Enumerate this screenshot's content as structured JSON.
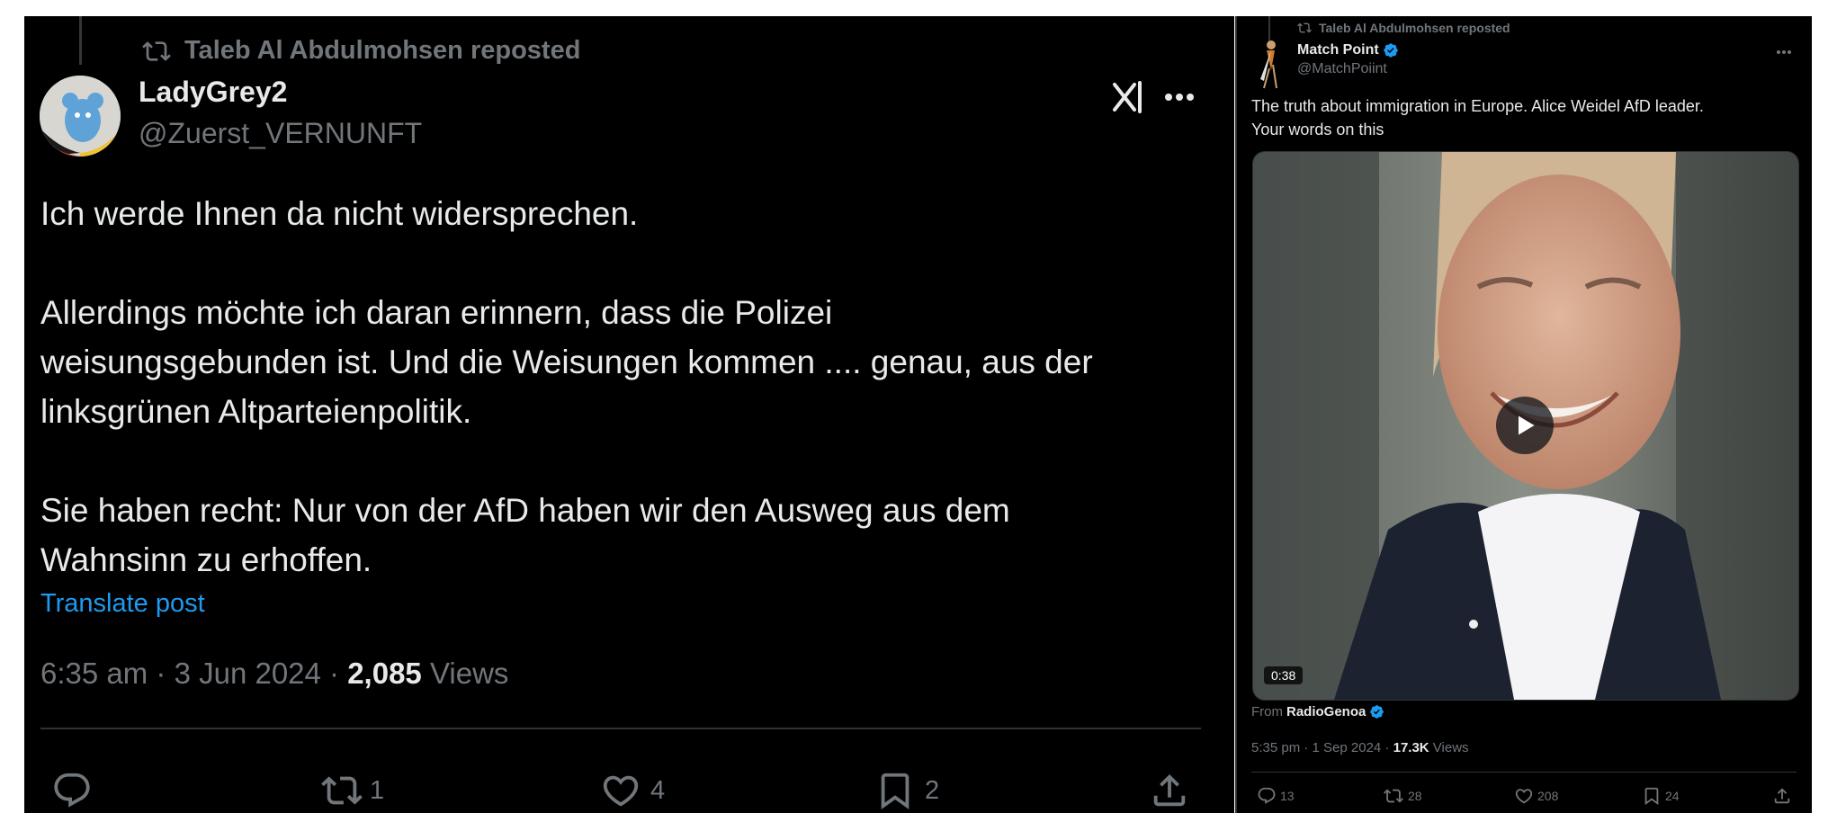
{
  "left": {
    "repost": {
      "text": "Taleb Al Abdulmohsen reposted"
    },
    "author": {
      "name": "LadyGrey2",
      "handle": "@Zuerst_VERNUNFT"
    },
    "body": "Ich werde Ihnen da nicht widersprechen.\n\nAllerdings möchte ich daran erinnern, dass die Polizei\nweisungsgebunden ist. Und die Weisungen kommen .... genau, aus der\nlinksgrünen Altparteienpolitik.\n\nSie haben recht: Nur von der AfD haben wir den Ausweg aus dem\nWahnsinn zu erhoffen.",
    "translate": "Translate post",
    "meta": {
      "time": "6:35 am · 3 Jun 2024 · ",
      "views_count": "2,085",
      "views_label": " Views"
    },
    "actions": {
      "replies": "",
      "reposts": "1",
      "likes": "4",
      "bookmarks": "2"
    }
  },
  "right": {
    "repost": {
      "text": "Taleb Al Abdulmohsen reposted"
    },
    "author": {
      "name": "Match Point",
      "handle": "@MatchPoiint"
    },
    "body": "The truth about immigration in Europe. Alice Weidel AfD leader.\nYour words on this",
    "video": {
      "duration": "0:38"
    },
    "source": {
      "prefix": "From ",
      "name": "RadioGenoa"
    },
    "meta": {
      "time": "5:35 pm · 1 Sep 2024 · ",
      "views_count": "17.3K",
      "views_label": " Views"
    },
    "actions": {
      "replies": "13",
      "reposts": "28",
      "likes": "208",
      "bookmarks": "24"
    }
  },
  "colors": {
    "background": "#000000",
    "text": "#e7e9ea",
    "muted": "#71767b",
    "link": "#1d9bf0",
    "verified": "#1d9bf0"
  }
}
